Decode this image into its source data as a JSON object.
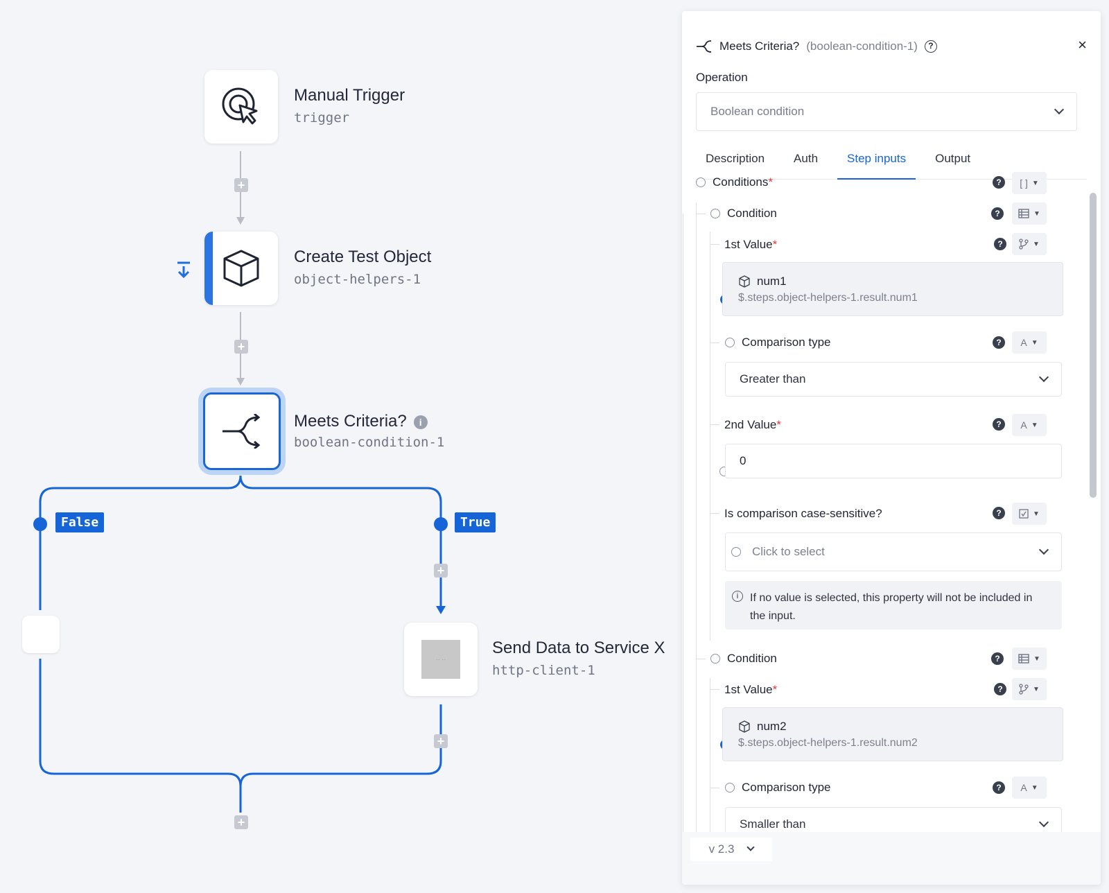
{
  "nodes": {
    "manual_trigger": {
      "title": "Manual Trigger",
      "id": "trigger"
    },
    "create_test_object": {
      "title": "Create Test Object",
      "id": "object-helpers-1"
    },
    "meets_criteria": {
      "title": "Meets Criteria?",
      "id": "boolean-condition-1"
    },
    "send_data": {
      "title": "Send Data to Service X",
      "id": "http-client-1",
      "thumb_text": "·· ··"
    }
  },
  "branches": {
    "false_label": "False",
    "true_label": "True"
  },
  "panel": {
    "title": "Meets Criteria?",
    "subtitle": "(boolean-condition-1)",
    "close": "×",
    "operation_label": "Operation",
    "operation_value": "Boolean condition",
    "tabs": [
      "Description",
      "Auth",
      "Step inputs",
      "Output"
    ],
    "active_tab": "Step inputs",
    "conditions_label": "Conditions",
    "conditions_type": "[ ]",
    "condition1": {
      "label": "Condition",
      "first_value_label": "1st Value",
      "ref_name": "num1",
      "ref_path": "$.steps.object-helpers-1.result.num1",
      "comparison_label": "Comparison type",
      "comparison_value": "Greater than",
      "second_value_label": "2nd Value",
      "second_value": "0",
      "case_label": "Is comparison case-sensitive?",
      "case_placeholder": "Click to select",
      "info_text": "If no value is selected, this property will not be included in the input."
    },
    "condition2": {
      "label": "Condition",
      "first_value_label": "1st Value",
      "ref_name": "num2",
      "ref_path": "$.steps.object-helpers-1.result.num2",
      "comparison_label": "Comparison type",
      "comparison_value": "Smaller than"
    },
    "required_mark": "*",
    "type_text": "A",
    "version": "v 2.3"
  }
}
